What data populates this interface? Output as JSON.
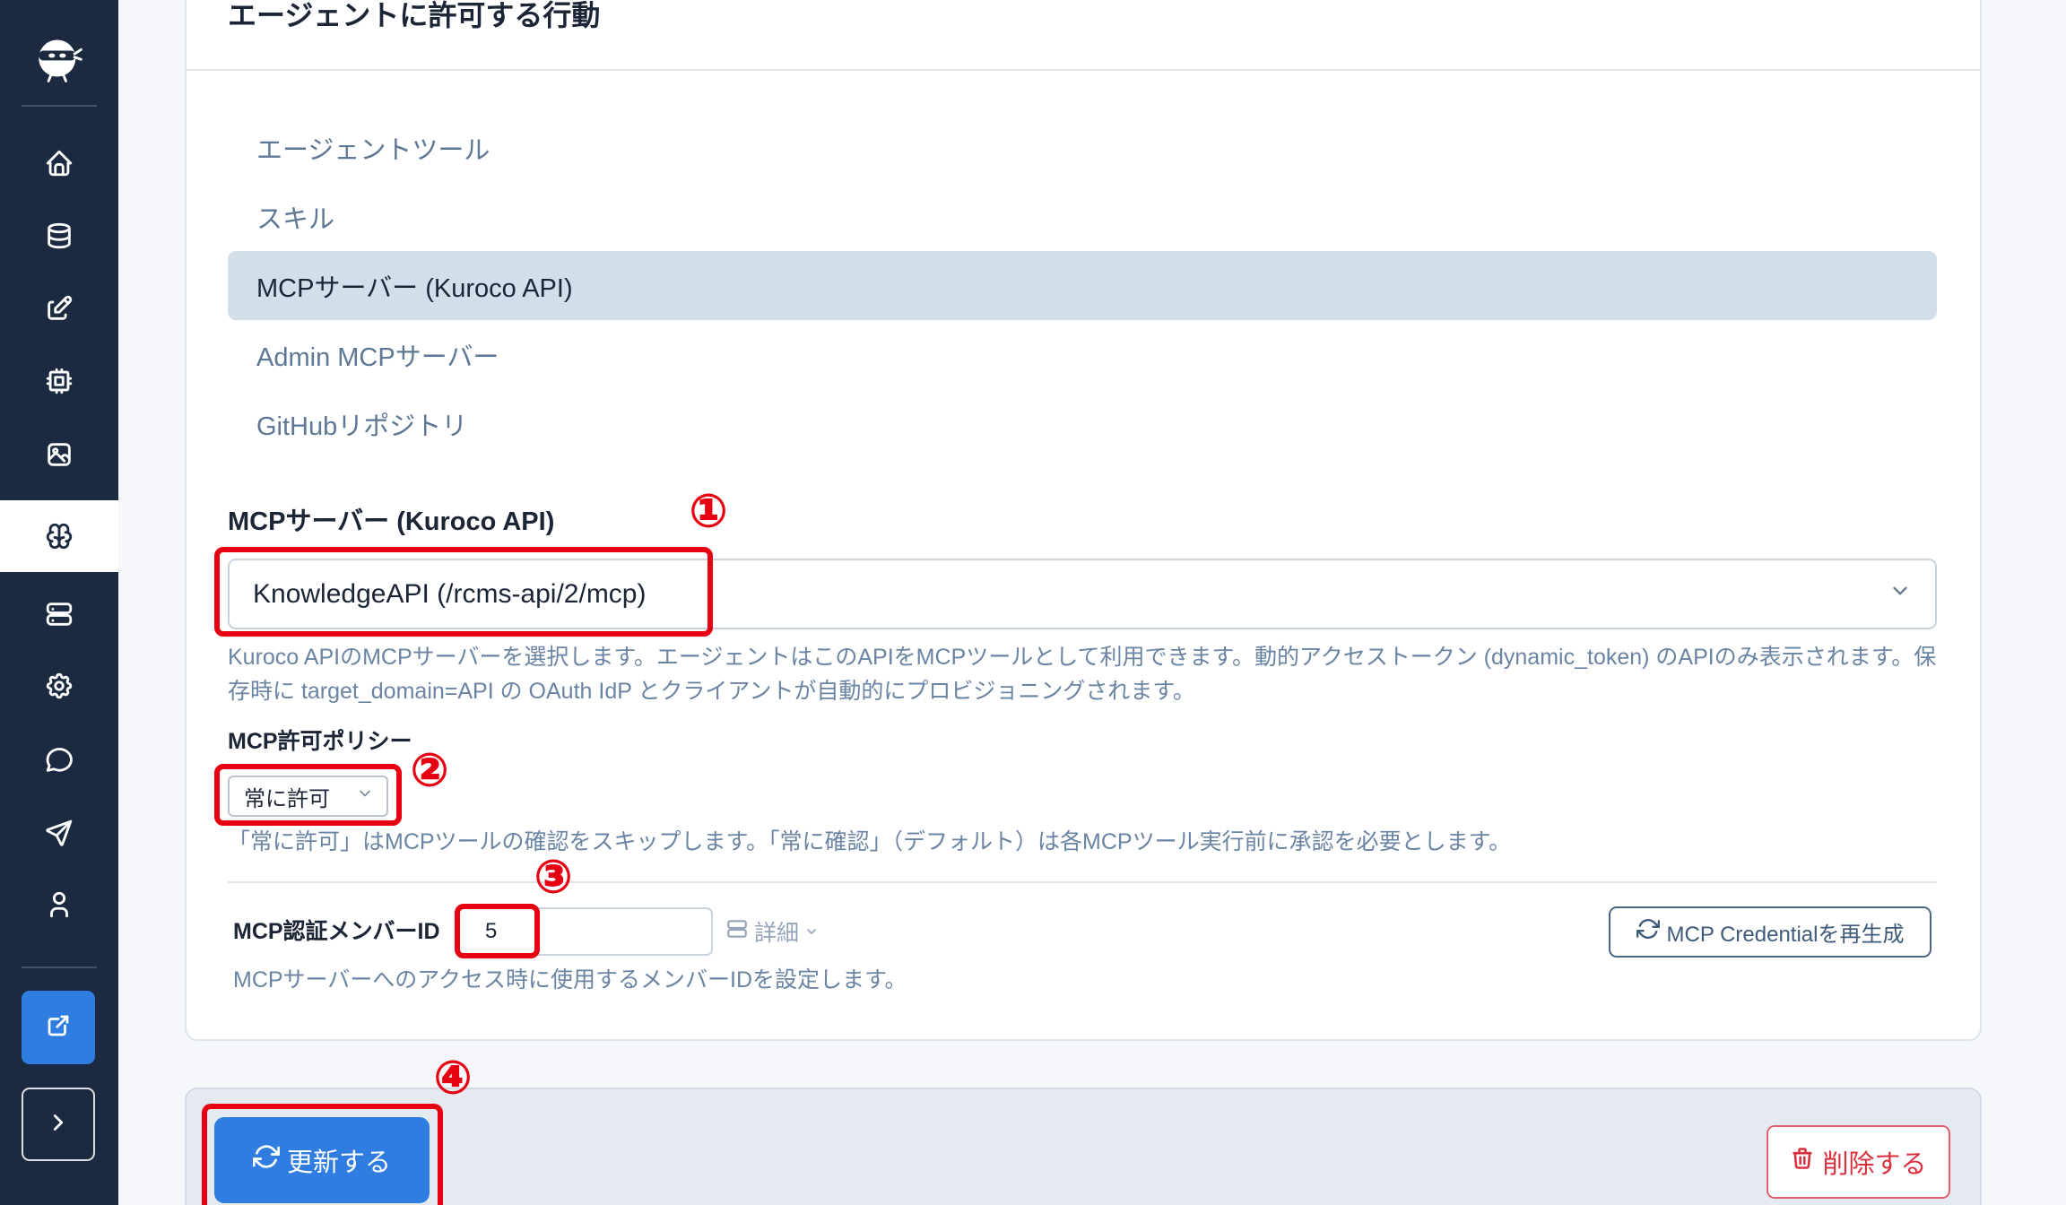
{
  "sidebar": {
    "logo_icon": "kuroco-ninja-logo-icon",
    "items": [
      {
        "icon": "home-icon",
        "active": false
      },
      {
        "icon": "database-icon",
        "active": false
      },
      {
        "icon": "edit-icon",
        "active": false
      },
      {
        "icon": "cpu-chip-icon",
        "active": false
      },
      {
        "icon": "image-icon",
        "active": false
      },
      {
        "icon": "brain-icon",
        "active": true
      },
      {
        "icon": "server-icon",
        "active": false
      },
      {
        "icon": "gear-icon",
        "active": false
      },
      {
        "icon": "chat-bubble-icon",
        "active": false
      },
      {
        "icon": "send-icon",
        "active": false
      },
      {
        "icon": "user-icon",
        "active": false
      }
    ],
    "open_external_icon": "external-link-icon",
    "expand_icon": "chevron-right-icon"
  },
  "card": {
    "title": "エージェントに許可する行動",
    "tabs": [
      {
        "label": "エージェントツール",
        "active": false
      },
      {
        "label": "スキル",
        "active": false
      },
      {
        "label": "MCPサーバー (Kuroco API)",
        "active": true
      },
      {
        "label": "Admin MCPサーバー",
        "active": false
      },
      {
        "label": "GitHubリポジトリ",
        "active": false
      }
    ],
    "mcp_server": {
      "label": "MCPサーバー (Kuroco API)",
      "value": "KnowledgeAPI (/rcms-api/2/mcp)",
      "help": "Kuroco APIのMCPサーバーを選択します。エージェントはこのAPIをMCPツールとして利用できます。動的アクセストークン (dynamic_token) のAPIのみ表示されます。保存時に target_domain=API の OAuth IdP とクライアントが自動的にプロビジョニングされます。"
    },
    "policy": {
      "label": "MCP許可ポリシー",
      "value": "常に許可",
      "help": "「常に許可」はMCPツールの確認をスキップします。「常に確認」（デフォルト）は各MCPツール実行前に承認を必要とします。"
    },
    "member_id": {
      "label": "MCP認証メンバーID",
      "value": "5",
      "details_label": "詳細",
      "help": "MCPサーバーへのアクセス時に使用するメンバーIDを設定します。"
    },
    "regenerate_label": "MCP Credentialを再生成"
  },
  "footer": {
    "update_label": "更新する",
    "delete_label": "削除する"
  },
  "annotations": {
    "one": "①",
    "two": "②",
    "three": "③",
    "four": "④"
  },
  "colors": {
    "sidebar_bg": "#1b2a41",
    "accent": "#2f7de1",
    "danger": "#d9303e",
    "annotation": "#e60012",
    "tab_active_bg": "#d4deea",
    "muted_text": "#6b84a3"
  }
}
